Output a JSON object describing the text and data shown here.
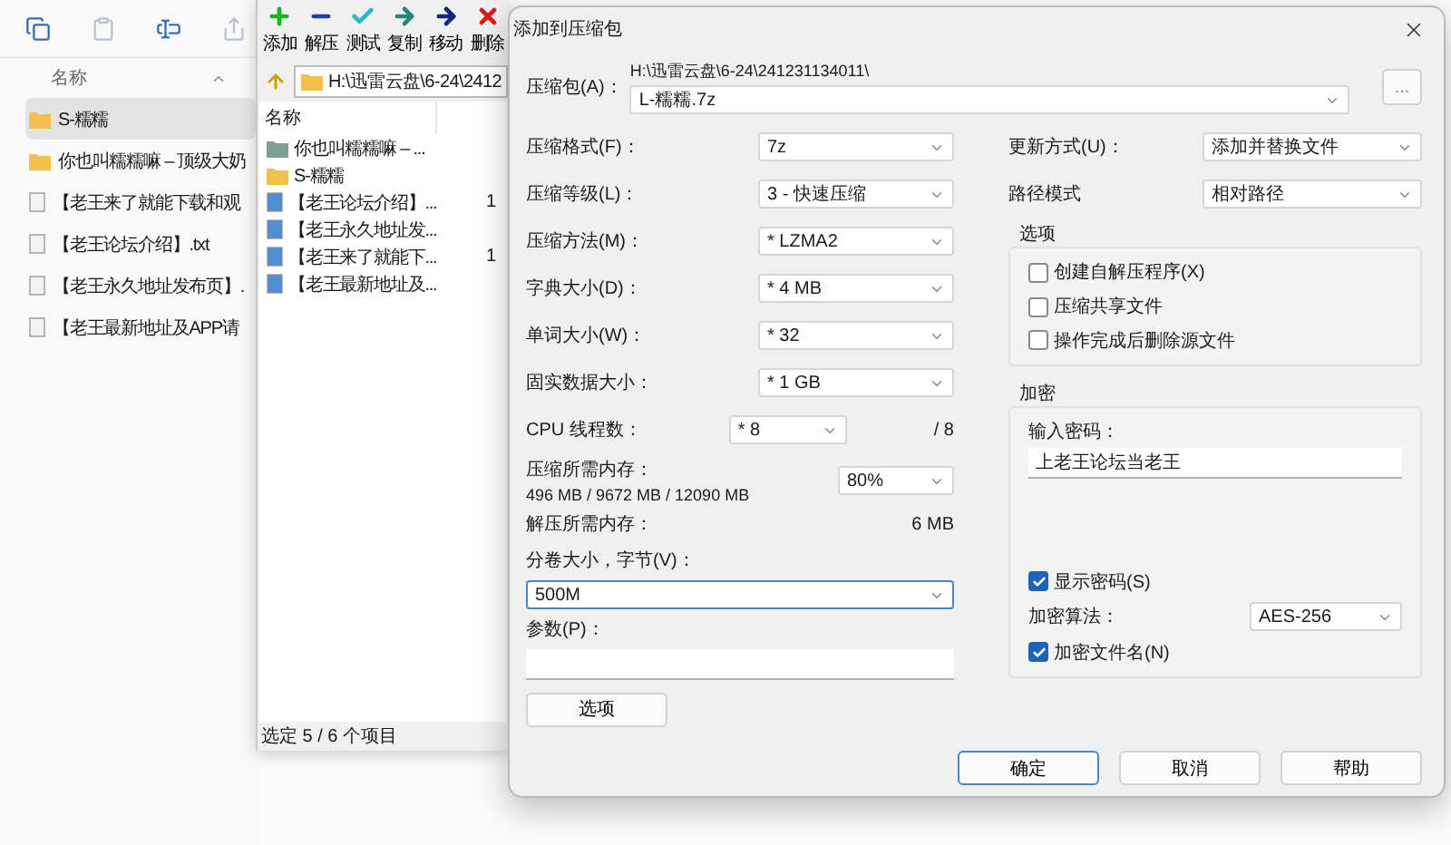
{
  "explorer": {
    "column": "名称",
    "items": [
      {
        "kind": "folder",
        "name": "S-糯糯",
        "selected": true
      },
      {
        "kind": "folder",
        "name": "你也叫糯糯嘛 – 顶级大奶",
        "selected": false
      },
      {
        "kind": "file",
        "name": "【老王来了就能下载和观",
        "selected": false
      },
      {
        "kind": "file",
        "name": "【老王论坛介绍】.txt",
        "selected": false
      },
      {
        "kind": "file",
        "name": "【老王永久地址发布页】.",
        "selected": false
      },
      {
        "kind": "file",
        "name": "【老王最新地址及APP请",
        "selected": false
      }
    ]
  },
  "archiver": {
    "toolbar": [
      {
        "kind": "add",
        "label": "添加"
      },
      {
        "kind": "extract",
        "label": "解压"
      },
      {
        "kind": "test",
        "label": "测试"
      },
      {
        "kind": "copy",
        "label": "复制"
      },
      {
        "kind": "move",
        "label": "移动"
      },
      {
        "kind": "delete",
        "label": "删除"
      }
    ],
    "path": "H:\\迅雷云盘\\6-24\\2412",
    "column": "名称",
    "files": [
      {
        "kind": "archive",
        "name": "你也叫糯糯嘛 – ..."
      },
      {
        "kind": "folder",
        "name": "S-糯糯"
      },
      {
        "kind": "file",
        "name": "【老王论坛介绍】...",
        "column_2": "1"
      },
      {
        "kind": "file",
        "name": "【老王永久地址发..."
      },
      {
        "kind": "file",
        "name": "【老王来了就能下...",
        "column_2": "1"
      },
      {
        "kind": "file",
        "name": "【老王最新地址及..."
      }
    ],
    "status": "选定 5 / 6 个项目"
  },
  "dialog": {
    "title": "添加到压缩包",
    "archive": {
      "label": "压缩包(A)：",
      "path": "H:\\迅雷云盘\\6-24\\241231134011\\",
      "value": "L-糯糯.7z",
      "browse": "..."
    },
    "left_rows": [
      {
        "label": "压缩格式(F)：",
        "value": "7z"
      },
      {
        "label": "压缩等级(L)：",
        "value": "3 - 快速压缩"
      },
      {
        "label": "压缩方法(M)：",
        "value": "* LZMA2"
      },
      {
        "label": "字典大小(D)：",
        "value": "* 4 MB"
      },
      {
        "label": "单词大小(W)：",
        "value": "* 32"
      },
      {
        "label": "固实数据大小：",
        "value": "* 1 GB"
      }
    ],
    "threads": {
      "label": "CPU 线程数：",
      "value": "* 8",
      "max": "/ 8"
    },
    "memory": {
      "label": "压缩所需内存：",
      "detail": "496 MB / 9672 MB / 12090 MB",
      "value": "80%"
    },
    "decompress_memory": {
      "label": "解压所需内存：",
      "value": "6 MB"
    },
    "volume": {
      "label": "分卷大小，字节(V)：",
      "value": "500M"
    },
    "parameters": {
      "label": "参数(P)："
    },
    "options_button": "选项",
    "right_rows": [
      {
        "label": "更新方式(U)：",
        "value": "添加并替换文件"
      },
      {
        "label": "路径模式",
        "value": "相对路径"
      }
    ],
    "options_group": {
      "title": "选项",
      "checkboxes": [
        {
          "label": "创建自解压程序(X)",
          "checked": false
        },
        {
          "label": "压缩共享文件",
          "checked": false
        },
        {
          "label": "操作完成后删除源文件",
          "checked": false
        }
      ]
    },
    "encryption": {
      "title": "加密",
      "password_label": "输入密码：",
      "password": "上老王论坛当老王",
      "show_password": {
        "label": "显示密码(S)",
        "checked": true
      },
      "method_label": "加密算法：",
      "method": "AES-256",
      "encrypt_names": {
        "label": "加密文件名(N)",
        "checked": true
      }
    },
    "buttons": [
      {
        "label": "确定",
        "default": true
      },
      {
        "label": "取消",
        "default": false
      },
      {
        "label": "帮助",
        "default": false
      }
    ]
  }
}
